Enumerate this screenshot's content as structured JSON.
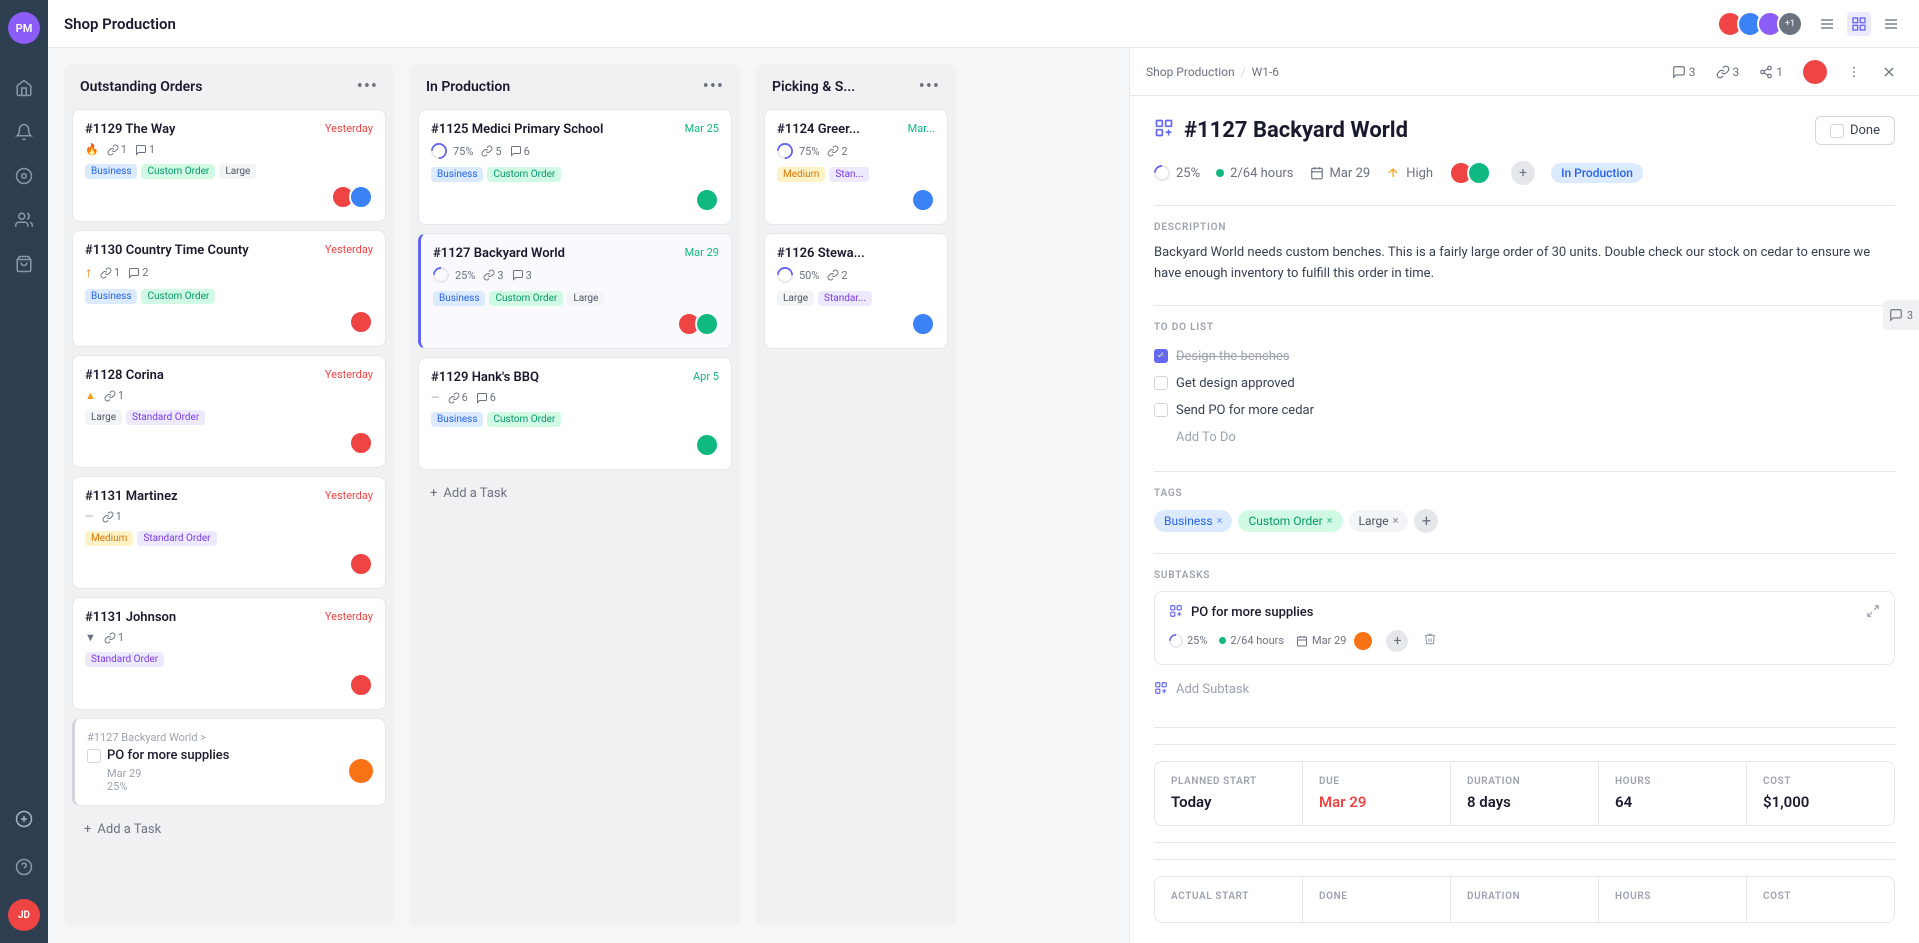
{
  "app": {
    "title": "Shop Production",
    "sidebar_items": [
      {
        "name": "home-icon",
        "icon": "⌂"
      },
      {
        "name": "bell-icon",
        "icon": "🔔"
      },
      {
        "name": "location-icon",
        "icon": "◎"
      },
      {
        "name": "user-icon",
        "icon": "👤"
      },
      {
        "name": "bag-icon",
        "icon": "🛍"
      },
      {
        "name": "plus-icon",
        "icon": "+"
      },
      {
        "name": "help-icon",
        "icon": "?"
      }
    ]
  },
  "topbar": {
    "title": "Shop Production",
    "view_icons": [
      "≡",
      "⠿",
      "≡"
    ]
  },
  "columns": [
    {
      "id": "outstanding",
      "title": "Outstanding Orders",
      "tasks": [
        {
          "id": "#1129 The Way",
          "date": "Yesterday",
          "date_color": "red",
          "priority": "high",
          "priority_icon": "🔥",
          "links": 1,
          "comments": 1,
          "tags": [
            "Business",
            "Custom Order",
            "Large"
          ],
          "assignees": [
            "red",
            "blue"
          ]
        },
        {
          "id": "#1130 Country Time County",
          "date": "Yesterday",
          "date_color": "red",
          "priority": "up",
          "priority_icon": "↑",
          "links": 1,
          "comments": 2,
          "tags": [
            "Business",
            "Custom Order"
          ],
          "assignees": [
            "red"
          ]
        },
        {
          "id": "#1128 Corina",
          "date": "Yesterday",
          "date_color": "red",
          "priority": "med",
          "priority_icon": "▲",
          "links": 1,
          "comments": 0,
          "tags": [
            "Large",
            "Standard Order"
          ],
          "assignees": [
            "red"
          ]
        },
        {
          "id": "#1131 Martinez",
          "date": "Yesterday",
          "date_color": "red",
          "priority": "low",
          "priority_icon": "—",
          "links": 1,
          "comments": 0,
          "tags": [
            "Medium",
            "Standard Order"
          ],
          "assignees": [
            "red"
          ]
        },
        {
          "id": "#1131 Johnson",
          "date": "Yesterday",
          "date_color": "red",
          "priority": "down",
          "priority_icon": "▼",
          "links": 1,
          "comments": 0,
          "tags": [
            "Standard Order"
          ],
          "assignees": [
            "red"
          ]
        }
      ],
      "add_task_label": "Add a Task"
    },
    {
      "id": "in_production",
      "title": "In Production",
      "tasks": [
        {
          "id": "#1125 Medici Primary School",
          "date": "Mar 25",
          "date_color": "green",
          "progress": 75,
          "links": 5,
          "comments": 6,
          "tags": [
            "Business",
            "Custom Order"
          ],
          "assignees": [
            "green"
          ]
        },
        {
          "id": "#1127 Backyard World",
          "date": "Mar 29",
          "date_color": "green",
          "progress": 25,
          "links": 3,
          "comments": 3,
          "tags": [
            "Business",
            "Custom Order",
            "Large"
          ],
          "assignees": [
            "red",
            "green"
          ],
          "highlighted": true
        },
        {
          "id": "#1129 Hank's BBQ",
          "date": "Apr 5",
          "date_color": "green",
          "progress": 0,
          "priority_icon": "—",
          "links": 6,
          "comments": 6,
          "tags": [
            "Business",
            "Custom Order"
          ],
          "assignees": [
            "green"
          ]
        }
      ],
      "add_task_label": "Add a Task"
    },
    {
      "id": "picking",
      "title": "Picking & S...",
      "tasks": [
        {
          "id": "#1124 Greer...",
          "date": "Mar...",
          "progress": 75,
          "links": 2,
          "tags": [
            "Medium",
            "Stan..."
          ],
          "assignees": [
            "blue"
          ]
        },
        {
          "id": "#1126 Stewa...",
          "date": "",
          "progress": 50,
          "links": 2,
          "tags": [
            "Large",
            "Standar..."
          ],
          "assignees": [
            "blue"
          ]
        }
      ],
      "add_task_label": "Add a Task"
    }
  ],
  "subtask_card": {
    "parent": "#1127 Backyard World >",
    "title": "PO for more supplies",
    "date": "Mar 29",
    "progress": 25,
    "assignees": [
      "orange"
    ]
  },
  "detail": {
    "breadcrumb": [
      "Shop Production",
      "W1-6"
    ],
    "comment_count": 3,
    "link_count": 3,
    "share_count": 1,
    "title": "#1127 Backyard World",
    "done_label": "Done",
    "meta": {
      "progress": "25%",
      "hours_done": "2/64 hours",
      "due_date": "Mar 29",
      "priority": "High",
      "status": "In Production"
    },
    "description_label": "DESCRIPTION",
    "description": "Backyard World needs custom benches. This is a fairly large order of 30 units. Double check our stock on cedar to ensure we have enough inventory to fulfill this order in time.",
    "todo_label": "TO DO LIST",
    "todos": [
      {
        "text": "Design the benches",
        "done": true
      },
      {
        "text": "Get design approved",
        "done": false
      },
      {
        "text": "Send PO for more cedar",
        "done": false
      }
    ],
    "todo_add_placeholder": "Add To Do",
    "tags_label": "TAGS",
    "tags": [
      {
        "label": "Business",
        "type": "business"
      },
      {
        "label": "Custom Order",
        "type": "custom"
      },
      {
        "label": "Large",
        "type": "large"
      }
    ],
    "subtasks_label": "SUBTASKS",
    "subtasks": [
      {
        "title": "PO for more supplies",
        "progress": "25%",
        "hours": "2/64 hours",
        "due": "Mar 29"
      }
    ],
    "add_subtask_label": "Add Subtask",
    "stats": [
      {
        "label": "PLANNED START",
        "value": "Today"
      },
      {
        "label": "DUE",
        "value": "Mar 29",
        "color": "red"
      },
      {
        "label": "DURATION",
        "value": "8 days"
      },
      {
        "label": "HOURS",
        "value": "64"
      },
      {
        "label": "COST",
        "value": "$1,000"
      }
    ],
    "stats2": [
      {
        "label": "ACTUAL START",
        "value": ""
      },
      {
        "label": "DONE",
        "value": ""
      },
      {
        "label": "DURATION",
        "value": ""
      },
      {
        "label": "HOURS",
        "value": ""
      },
      {
        "label": "COST",
        "value": ""
      }
    ]
  }
}
